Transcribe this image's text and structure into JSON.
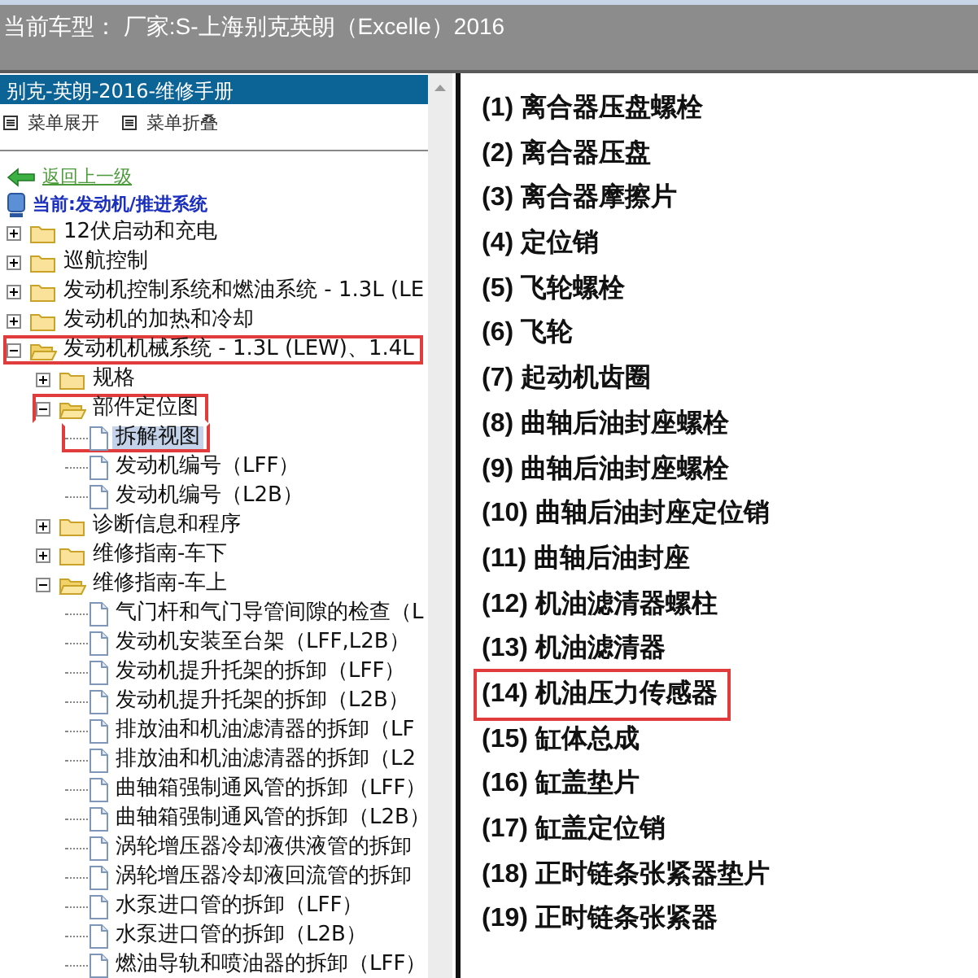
{
  "header": {
    "model_label": "当前车型： 厂家:S-上海别克英朗（Excelle）2016"
  },
  "sidebar": {
    "title": "别克-英朗-2016-维修手册",
    "toolbar": [
      "菜单展开",
      "菜单折叠"
    ],
    "back_link": "返回上一级",
    "current_path": "当前:发动机/推进系统",
    "tree": [
      {
        "kind": "folder",
        "label": "12伏启动和充电",
        "expanded": false,
        "selected": false,
        "highlighted": false
      },
      {
        "kind": "folder",
        "label": "巡航控制",
        "expanded": false,
        "selected": false,
        "highlighted": false
      },
      {
        "kind": "folder",
        "label": "发动机控制系统和燃油系统 - 1.3L (LE",
        "expanded": false,
        "selected": false,
        "highlighted": false
      },
      {
        "kind": "folder",
        "label": "发动机的加热和冷却",
        "expanded": false,
        "selected": false,
        "highlighted": false
      },
      {
        "kind": "folder",
        "label": "发动机机械系统 - 1.3L (LEW)、1.4L",
        "expanded": true,
        "selected": false,
        "highlighted": true,
        "children": [
          {
            "kind": "folder",
            "label": "规格",
            "expanded": false,
            "selected": false,
            "highlighted": false
          },
          {
            "kind": "folder",
            "label": "部件定位图",
            "expanded": true,
            "selected": false,
            "highlighted": true,
            "children": [
              {
                "kind": "page",
                "label": "拆解视图",
                "selected": true,
                "highlighted": true
              },
              {
                "kind": "page",
                "label": "发动机编号（LFF）",
                "selected": false,
                "highlighted": false
              },
              {
                "kind": "page",
                "label": "发动机编号（L2B）",
                "selected": false,
                "highlighted": false
              }
            ]
          },
          {
            "kind": "folder",
            "label": "诊断信息和程序",
            "expanded": false,
            "selected": false,
            "highlighted": false
          },
          {
            "kind": "folder",
            "label": "维修指南-车下",
            "expanded": false,
            "selected": false,
            "highlighted": false
          },
          {
            "kind": "folder",
            "label": "维修指南-车上",
            "expanded": true,
            "selected": false,
            "highlighted": false,
            "children": [
              {
                "kind": "page",
                "label": "气门杆和气门导管间隙的检查（L",
                "selected": false,
                "highlighted": false
              },
              {
                "kind": "page",
                "label": "发动机安装至台架（LFF,L2B）",
                "selected": false,
                "highlighted": false
              },
              {
                "kind": "page",
                "label": "发动机提升托架的拆卸（LFF）",
                "selected": false,
                "highlighted": false
              },
              {
                "kind": "page",
                "label": "发动机提升托架的拆卸（L2B）",
                "selected": false,
                "highlighted": false
              },
              {
                "kind": "page",
                "label": "排放油和机油滤清器的拆卸（LF",
                "selected": false,
                "highlighted": false
              },
              {
                "kind": "page",
                "label": "排放油和机油滤清器的拆卸（L2",
                "selected": false,
                "highlighted": false
              },
              {
                "kind": "page",
                "label": "曲轴箱强制通风管的拆卸（LFF）",
                "selected": false,
                "highlighted": false
              },
              {
                "kind": "page",
                "label": "曲轴箱强制通风管的拆卸（L2B）",
                "selected": false,
                "highlighted": false
              },
              {
                "kind": "page",
                "label": "涡轮增压器冷却液供液管的拆卸",
                "selected": false,
                "highlighted": false
              },
              {
                "kind": "page",
                "label": "涡轮增压器冷却液回流管的拆卸",
                "selected": false,
                "highlighted": false
              },
              {
                "kind": "page",
                "label": "水泵进口管的拆卸（LFF）",
                "selected": false,
                "highlighted": false
              },
              {
                "kind": "page",
                "label": "水泵进口管的拆卸（L2B）",
                "selected": false,
                "highlighted": false
              },
              {
                "kind": "page",
                "label": "燃油导轨和喷油器的拆卸（LFF）",
                "selected": false,
                "highlighted": false
              }
            ]
          }
        ]
      }
    ]
  },
  "parts": [
    {
      "label": "(1) 离合器压盘螺栓",
      "highlighted": false
    },
    {
      "label": "(2) 离合器压盘",
      "highlighted": false
    },
    {
      "label": "(3) 离合器摩擦片",
      "highlighted": false
    },
    {
      "label": "(4) 定位销",
      "highlighted": false
    },
    {
      "label": "(5) 飞轮螺栓",
      "highlighted": false
    },
    {
      "label": "(6) 飞轮",
      "highlighted": false
    },
    {
      "label": "(7) 起动机齿圈",
      "highlighted": false
    },
    {
      "label": "(8) 曲轴后油封座螺栓",
      "highlighted": false
    },
    {
      "label": "(9) 曲轴后油封座螺栓",
      "highlighted": false
    },
    {
      "label": "(10) 曲轴后油封座定位销",
      "highlighted": false
    },
    {
      "label": "(11) 曲轴后油封座",
      "highlighted": false
    },
    {
      "label": "(12) 机油滤清器螺柱",
      "highlighted": false
    },
    {
      "label": "(13) 机油滤清器",
      "highlighted": false
    },
    {
      "label": "(14) 机油压力传感器",
      "highlighted": true
    },
    {
      "label": "(15) 缸体总成",
      "highlighted": false
    },
    {
      "label": "(16) 缸盖垫片",
      "highlighted": false
    },
    {
      "label": "(17) 缸盖定位销",
      "highlighted": false
    },
    {
      "label": "(18) 正时链条张紧器垫片",
      "highlighted": false
    },
    {
      "label": "(19) 正时链条张紧器",
      "highlighted": false
    }
  ]
}
